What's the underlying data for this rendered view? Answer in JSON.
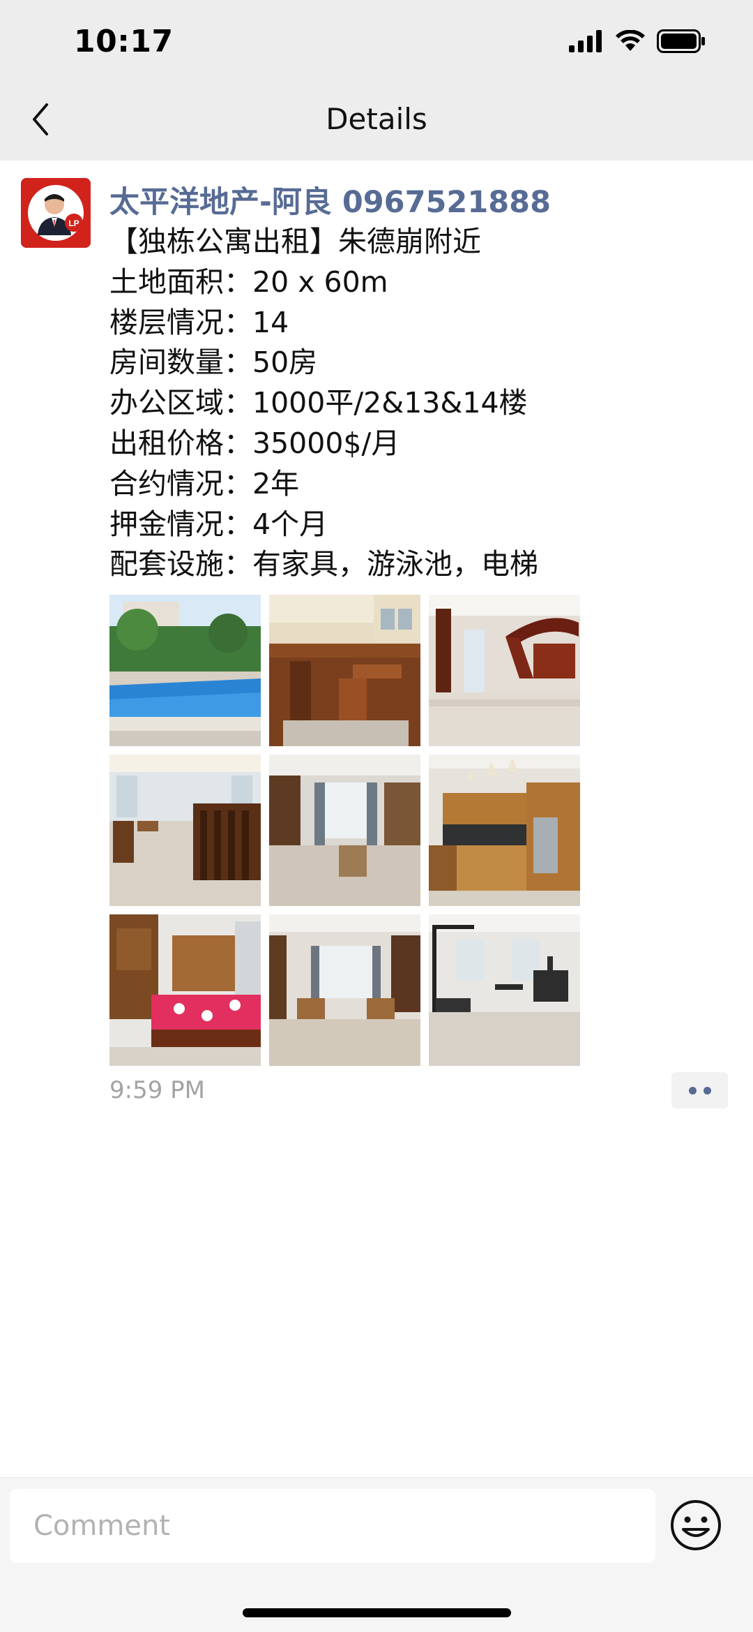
{
  "status_bar": {
    "time": "10:17",
    "icons": [
      "signal-icon",
      "wifi-icon",
      "battery-icon"
    ]
  },
  "nav": {
    "title": "Details",
    "back_icon": "chevron-left-icon"
  },
  "post": {
    "author": "太平洋地产-阿良 0967521888",
    "avatar_badge": "LP",
    "lines": [
      "【独栋公寓出租】朱德崩附近",
      "土地面积：20 x 60m",
      "楼层情况：14",
      "房间数量：50房",
      "办公区域：1000平/2&13&14楼",
      "出租价格：35000$/月",
      "合约情况：2年",
      "押金情况：4个月",
      "配套设施：有家具，游泳池，电梯"
    ],
    "photos": [
      "pool-photo",
      "wooden-staircase-photo",
      "spiral-staircase-lobby-photo",
      "dining-hall-photo",
      "living-room-photo",
      "kitchen-photo",
      "bedroom-photo",
      "sofa-lounge-photo",
      "gym-photo"
    ],
    "time": "9:59 PM",
    "more_icon": "more-dots-icon"
  },
  "comment": {
    "placeholder": "Comment",
    "emoji_icon": "smiley-icon"
  },
  "colors": {
    "link_blue": "#576b95",
    "header_bg": "#ededed",
    "timestamp": "#a3a3a3",
    "avatar_red": "#d1221c"
  }
}
